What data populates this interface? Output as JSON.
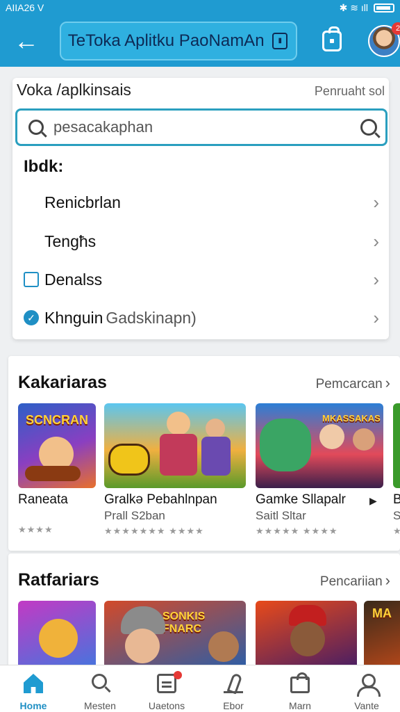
{
  "statusbar": {
    "time": "AIIA26 V",
    "icons": "⚙ ▮",
    "right_icons": "✱ ≋ ıll"
  },
  "appbar": {
    "title": "TeToka Aplitku PaoNamAn",
    "back_icon": "arrow-left-icon",
    "bag_icon": "shopping-bag-icon",
    "avatar_badge": "2"
  },
  "search_card": {
    "heading": "Voka /aplkinsais",
    "heading_right": "Penruaht sol",
    "search": {
      "value": "",
      "placeholder": "pesacakaphan"
    },
    "filter_label": "Ibdk:",
    "options": [
      {
        "label": "Renicbrlan",
        "sub": "",
        "checkbox": "none"
      },
      {
        "label": "Tengħs",
        "sub": "",
        "checkbox": "none"
      },
      {
        "label": "Denalss",
        "sub": "",
        "checkbox": "unchecked"
      },
      {
        "label": "Khnguin",
        "sub": "Gadskinapn)",
        "checkbox": "checked"
      }
    ]
  },
  "section1": {
    "title": "Kakariaras",
    "more_label": "Pemcarcan",
    "games": [
      {
        "name": "Raneata",
        "sub": "",
        "stars": "★★★★",
        "art_text": "SCNCRAN"
      },
      {
        "name": "Gralkә Pebahlnpan",
        "sub": "Prall S2ban",
        "stars": "★★★★★★★  ★★★★",
        "art_text": ""
      },
      {
        "name": "Gamke Sllapalr",
        "sub": "Saitl Sltar",
        "stars": "★★★★★  ★★★★",
        "art_text": "MKASSAKAS"
      },
      {
        "name": "B",
        "sub": "S",
        "stars": "★",
        "art_text": ""
      }
    ]
  },
  "section2": {
    "title": "Ratfariars",
    "more_label": "Pencariian",
    "games": [
      {
        "art_text": ""
      },
      {
        "art_text": "SONKIS FNARC"
      },
      {
        "art_text": ""
      },
      {
        "art_text": "MA"
      }
    ]
  },
  "bottom_nav": [
    {
      "label": "Home",
      "icon": "home-icon",
      "active": true
    },
    {
      "label": "Mesten",
      "icon": "search-icon",
      "active": false
    },
    {
      "label": "Uaetons",
      "icon": "updates-icon",
      "active": false
    },
    {
      "label": "Ebor",
      "icon": "eboor-icon",
      "active": false
    },
    {
      "label": "Marn",
      "icon": "market-icon",
      "active": false
    },
    {
      "label": "Vante",
      "icon": "user-icon",
      "active": false
    }
  ],
  "colors": {
    "primary": "#1f9bd1",
    "accent": "#2a9fbf",
    "badge": "#e53935"
  }
}
